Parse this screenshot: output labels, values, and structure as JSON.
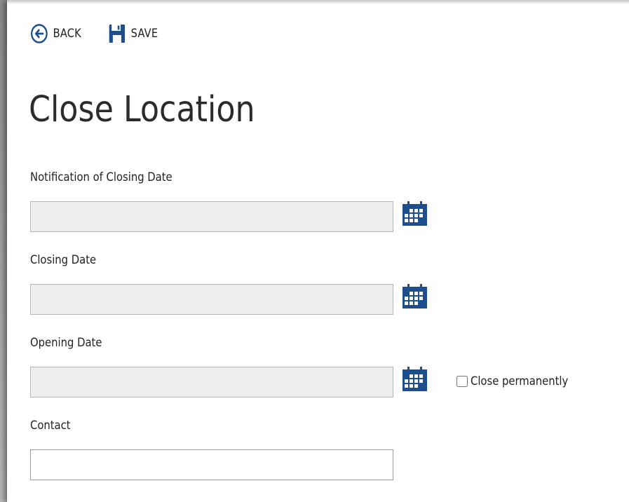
{
  "toolbar": {
    "back_label": "BACK",
    "save_label": "SAVE"
  },
  "page": {
    "title": "Close Location"
  },
  "form": {
    "notification_of_closing_date": {
      "label": "Notification of Closing Date",
      "value": ""
    },
    "closing_date": {
      "label": "Closing Date",
      "value": ""
    },
    "opening_date": {
      "label": "Opening Date",
      "value": ""
    },
    "close_permanently": {
      "label": "Close permanently",
      "checked": false
    },
    "contact": {
      "label": "Contact",
      "value": ""
    }
  },
  "icons": {
    "back": "arrow-left-circle-icon",
    "save": "floppy-disk-icon",
    "calendar": "calendar-icon"
  },
  "colors": {
    "accent": "#1d4f8f",
    "disabled_field": "#eeeeee"
  }
}
